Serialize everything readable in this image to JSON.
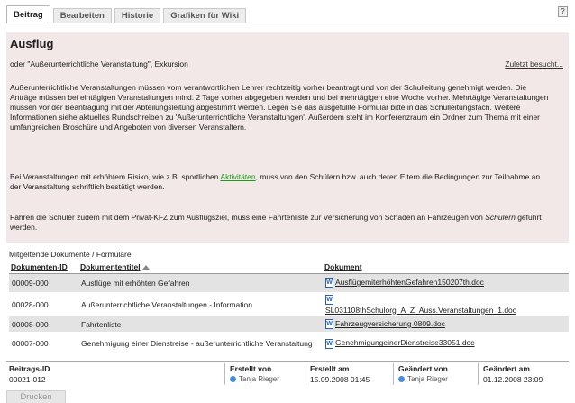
{
  "tabs": [
    {
      "label": "Beitrag",
      "active": true
    },
    {
      "label": "Bearbeiten",
      "active": false
    },
    {
      "label": "Historie",
      "active": false
    },
    {
      "label": "Grafiken für Wiki",
      "active": false
    }
  ],
  "help": "?",
  "article": {
    "title": "Ausflug",
    "subtitle": "oder \"Außerunterrichtliche Veranstaltung\", Exkursion",
    "recent_link": "Zuletzt besucht...",
    "p1": "Außerunterrichtliche Veranstaltungen müssen vom verantwortlichen Lehrer rechtzeitig vorher beantragt und von der Schulleitung genehmigt werden. Die Anträge müssen bei eintägigen Veranstaltungen mind. 2 Tage vorher abgegeben werden und bei mehrtägigen eine Woche vorher. Mehrtägige Veranstaltungen müssen vor der Beantragung mit der Abteilungsleitung abgestimmt werden. Legen Sie das ausgefüllte Formular bitte in das Schulleitungsfach. Weitere Informationen siehe aktuelles Rundschreiben zu 'Außerunterrichtliche Veranstaltungen'. Außerdem steht im Konferenzraum ein Ordner zum Thema mit einer umfangreichen Broschüre und Angeboten von diversen Veranstaltern.",
    "p2_before": "Bei Veranstaltungen mit erhöhtem Risiko, wie z.B. sportlichen ",
    "p2_link": "Aktivitäten",
    "p2_after": ", muss von den Schülern bzw. auch deren Eltern die Bedingungen zur Teilnahme an der Veranstaltung schriftlich bestätigt werden.",
    "p3_before": "Fahren die Schüler zudem mit dem Privat-KFZ zum Ausflugsziel, muss eine Fahrtenliste zur Versicherung von Schäden an Fahrzeugen von ",
    "p3_italic": "Schülern",
    "p3_after": " geführt werden."
  },
  "documents": {
    "heading": "Mitgeltende Dokumente / Formulare",
    "columns": [
      "Dokumenten-ID",
      "Dokumententitel",
      "Dokument"
    ],
    "rows": [
      {
        "id": "00009-000",
        "title": "Ausflüge mit erhöhten Gefahren",
        "file": "AusflügemiterhöhtenGefahren150207th.doc"
      },
      {
        "id": "00028-000",
        "title": "Außerunterrichtliche Veranstaltungen - Information",
        "file": "SL031108thSchulorg_A_Z_Auss.Veranstaltungen_1.doc"
      },
      {
        "id": "00008-000",
        "title": "Fahrtenliste",
        "file": "Fahrzeugversicherung 0809.doc"
      },
      {
        "id": "00007-000",
        "title": "Genehmigung einer Dienstreise - außerunterrichtliche Veranstaltung",
        "file": "GenehmigungeinerDienstreise33051.doc"
      }
    ]
  },
  "meta": {
    "id_label": "Beitrags-ID",
    "id_value": "00021-012",
    "created_by_label": "Erstellt von",
    "created_by": "Tanja Rieger",
    "created_at_label": "Erstellt am",
    "created_at": "15.09.2008 01:45",
    "changed_by_label": "Geändert von",
    "changed_by": "Tanja Rieger",
    "changed_at_label": "Geändert am",
    "changed_at": "01.12.2008 23:09"
  },
  "print_label": "Drucken"
}
